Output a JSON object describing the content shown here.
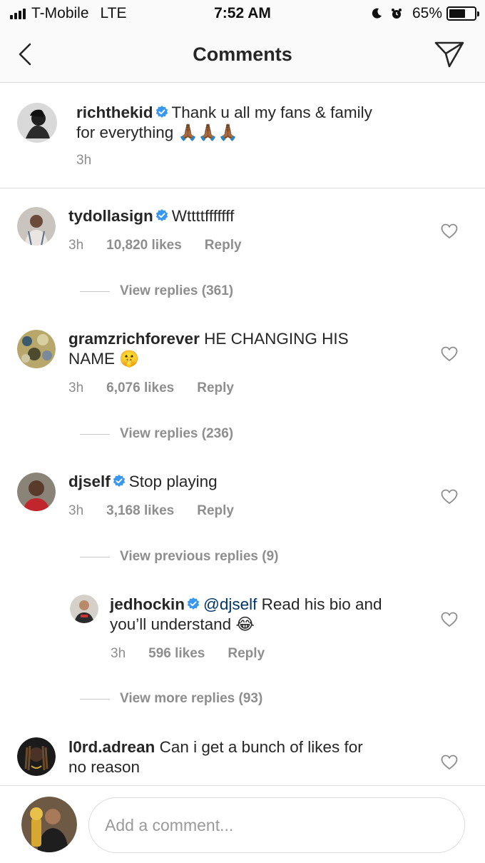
{
  "status_bar": {
    "carrier": "T-Mobile",
    "network": "LTE",
    "time": "7:52 AM",
    "battery": "65%",
    "battery_level": 0.65
  },
  "header": {
    "title": "Comments",
    "back_icon": "chevron-left-icon",
    "share_icon": "paper-plane-icon"
  },
  "caption": {
    "username": "richthekid",
    "text_line1": "Thank u all my fans & family",
    "text_line2": "for everything",
    "emoji": "🙏🏾🙏🏾🙏🏾",
    "time": "3h"
  },
  "comments": [
    {
      "username": "tydollasign",
      "text": "Wttttfffffff",
      "time": "3h",
      "likes": "10,820 likes",
      "reply": "Reply",
      "view_replies": "View replies (361)"
    },
    {
      "username": "gramzrichforever",
      "text_line1": "HE CHANGING HIS",
      "text_line2": "NAME",
      "emoji": "🤫",
      "time": "3h",
      "likes": "6,076 likes",
      "reply": "Reply",
      "view_replies": "View replies (236)"
    },
    {
      "username": "djself",
      "text": "Stop playing",
      "time": "3h",
      "likes": "3,168 likes",
      "reply": "Reply",
      "view_replies": "View previous replies (9)"
    },
    {
      "username": "jedhockin",
      "mention": "@djself",
      "text_line1": "Read his bio and",
      "text_line2": "you’ll understand",
      "emoji": "😂",
      "time": "3h",
      "likes": "596 likes",
      "reply": "Reply",
      "view_replies": "View more replies (93)"
    },
    {
      "username": "l0rd.adrean",
      "text_line1": "Can i get a bunch of likes for",
      "text_line2": "no reason"
    }
  ],
  "composer": {
    "placeholder": "Add a comment..."
  },
  "colors": {
    "verified_blue": "#3897f0",
    "secondary_text": "#8e8e8e",
    "mention_blue": "#003569",
    "divider": "#dbdbdb"
  }
}
